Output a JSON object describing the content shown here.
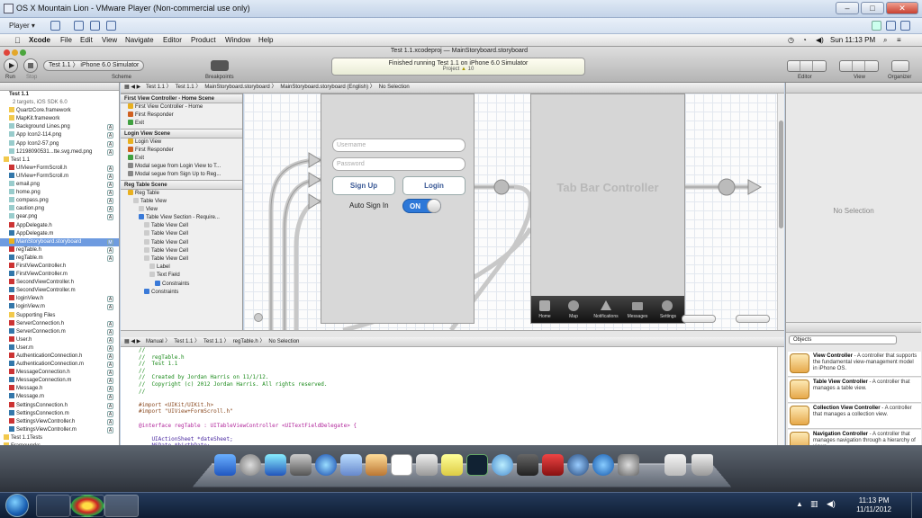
{
  "vmware": {
    "title": "OS X Mountain Lion - VMware Player (Non-commercial use only)",
    "player_menu": "Player"
  },
  "menubar": {
    "app": "Xcode",
    "items": [
      "File",
      "Edit",
      "View",
      "Navigate",
      "Editor",
      "Product",
      "Window",
      "Help"
    ],
    "clock": "Sun 11:13 PM"
  },
  "toolbar": {
    "run_label": "Run",
    "stop_label": "Stop",
    "scheme_label": "Scheme",
    "scheme_target": "Test 1.1",
    "scheme_dest": "iPhone 6.0 Simulator",
    "breakpoints_label": "Breakpoints",
    "window_title": "Test 1.1.xcodeproj — MainStoryboard.storyboard",
    "activity_text": "Finished running Test 1.1 on iPhone 6.0 Simulator",
    "activity_project": "Project",
    "activity_count": "10",
    "editor_label": "Editor",
    "view_label": "View",
    "organizer_label": "Organizer"
  },
  "jumpbar_top": {
    "items": [
      "Test 1.1",
      "Test 1.1",
      "MainStoryboard.storyboard",
      "MainStoryboard.storyboard (English)",
      "No Selection"
    ]
  },
  "navigator": {
    "project": "Test 1.1",
    "project_sub": "2 targets, iOS SDK 6.0",
    "files": [
      {
        "name": "QuartzCore.framework",
        "type": "folder",
        "indent": 1,
        "mark": ""
      },
      {
        "name": "MapKit.framework",
        "type": "folder",
        "indent": 1,
        "mark": ""
      },
      {
        "name": "Background Lines.png",
        "type": "img",
        "indent": 1,
        "mark": "A"
      },
      {
        "name": "App Icon2-114.png",
        "type": "img",
        "indent": 1,
        "mark": "A"
      },
      {
        "name": "App Icon2-57.png",
        "type": "img",
        "indent": 1,
        "mark": "A"
      },
      {
        "name": "12198090531...tte.svg.med.png",
        "type": "img",
        "indent": 1,
        "mark": "A"
      },
      {
        "name": "Test 1.1",
        "type": "folder",
        "indent": 0,
        "mark": ""
      },
      {
        "name": "UIView+FormScroll.h",
        "type": "h",
        "indent": 1,
        "mark": "A"
      },
      {
        "name": "UIView+FormScroll.m",
        "type": "m",
        "indent": 1,
        "mark": "A"
      },
      {
        "name": "email.png",
        "type": "img",
        "indent": 1,
        "mark": "A"
      },
      {
        "name": "home.png",
        "type": "img",
        "indent": 1,
        "mark": "A"
      },
      {
        "name": "compass.png",
        "type": "img",
        "indent": 1,
        "mark": "A"
      },
      {
        "name": "caution.png",
        "type": "img",
        "indent": 1,
        "mark": "A"
      },
      {
        "name": "gear.png",
        "type": "img",
        "indent": 1,
        "mark": "A"
      },
      {
        "name": "AppDelegate.h",
        "type": "h",
        "indent": 1,
        "mark": ""
      },
      {
        "name": "AppDelegate.m",
        "type": "m",
        "indent": 1,
        "mark": ""
      },
      {
        "name": "MainStoryboard.storyboard",
        "type": "sb",
        "indent": 1,
        "mark": "M",
        "selected": true
      },
      {
        "name": "regTable.h",
        "type": "h",
        "indent": 1,
        "mark": "A"
      },
      {
        "name": "regTable.m",
        "type": "m",
        "indent": 1,
        "mark": "A"
      },
      {
        "name": "FirstViewController.h",
        "type": "h",
        "indent": 1,
        "mark": ""
      },
      {
        "name": "FirstViewController.m",
        "type": "m",
        "indent": 1,
        "mark": ""
      },
      {
        "name": "SecondViewController.h",
        "type": "h",
        "indent": 1,
        "mark": ""
      },
      {
        "name": "SecondViewController.m",
        "type": "m",
        "indent": 1,
        "mark": ""
      },
      {
        "name": "loginView.h",
        "type": "h",
        "indent": 1,
        "mark": "A"
      },
      {
        "name": "loginView.m",
        "type": "m",
        "indent": 1,
        "mark": "A"
      },
      {
        "name": "Supporting Files",
        "type": "folder",
        "indent": 1,
        "mark": ""
      },
      {
        "name": "ServerConnection.h",
        "type": "h",
        "indent": 1,
        "mark": "A"
      },
      {
        "name": "ServerConnection.m",
        "type": "m",
        "indent": 1,
        "mark": "A"
      },
      {
        "name": "User.h",
        "type": "h",
        "indent": 1,
        "mark": "A"
      },
      {
        "name": "User.m",
        "type": "m",
        "indent": 1,
        "mark": "A"
      },
      {
        "name": "AuthenticationConnection.h",
        "type": "h",
        "indent": 1,
        "mark": "A"
      },
      {
        "name": "AuthenticationConnection.m",
        "type": "m",
        "indent": 1,
        "mark": "A"
      },
      {
        "name": "MessageConnection.h",
        "type": "h",
        "indent": 1,
        "mark": "A"
      },
      {
        "name": "MessageConnection.m",
        "type": "m",
        "indent": 1,
        "mark": "A"
      },
      {
        "name": "Message.h",
        "type": "h",
        "indent": 1,
        "mark": "A"
      },
      {
        "name": "Message.m",
        "type": "m",
        "indent": 1,
        "mark": "A"
      },
      {
        "name": "SettingsConnection.h",
        "type": "h",
        "indent": 1,
        "mark": "A"
      },
      {
        "name": "SettingsConnection.m",
        "type": "m",
        "indent": 1,
        "mark": "A"
      },
      {
        "name": "SettingsViewController.h",
        "type": "h",
        "indent": 1,
        "mark": "A"
      },
      {
        "name": "SettingsViewController.m",
        "type": "m",
        "indent": 1,
        "mark": "A"
      },
      {
        "name": "Test 1.1Tests",
        "type": "folder",
        "indent": 0,
        "mark": ""
      },
      {
        "name": "Frameworks",
        "type": "folder",
        "indent": 0,
        "mark": ""
      }
    ]
  },
  "outline": {
    "sections": [
      {
        "title": "First View Controller - Home Scene",
        "rows": [
          {
            "t": "First View Controller - Home",
            "c": "#e8b020",
            "i": 1
          },
          {
            "t": "First Responder",
            "c": "#d06020",
            "i": 1
          },
          {
            "t": "Exit",
            "c": "#40a040",
            "i": 1
          }
        ]
      },
      {
        "title": "Login View Scene",
        "rows": [
          {
            "t": "Login View",
            "c": "#e8b020",
            "i": 1
          },
          {
            "t": "First Responder",
            "c": "#d06020",
            "i": 1
          },
          {
            "t": "Exit",
            "c": "#40a040",
            "i": 1
          },
          {
            "t": "Modal segue from Login View to T...",
            "c": "#888888",
            "i": 1
          },
          {
            "t": "Modal segue from Sign Up to Reg...",
            "c": "#888888",
            "i": 1
          }
        ]
      },
      {
        "title": "Reg Table Scene",
        "rows": [
          {
            "t": "Reg Table",
            "c": "#e8b020",
            "i": 1
          },
          {
            "t": "Table View",
            "c": "#cccccc",
            "i": 2
          },
          {
            "t": "View",
            "c": "#cccccc",
            "i": 3
          },
          {
            "t": "Table View Section - Require...",
            "c": "#3a7ad8",
            "i": 3
          },
          {
            "t": "Table View Cell",
            "c": "#cccccc",
            "i": 4
          },
          {
            "t": "Table View Cell",
            "c": "#cccccc",
            "i": 4
          },
          {
            "t": "Table View Cell",
            "c": "#cccccc",
            "i": 4
          },
          {
            "t": "Table View Cell",
            "c": "#cccccc",
            "i": 4
          },
          {
            "t": "Table View Cell",
            "c": "#cccccc",
            "i": 4
          },
          {
            "t": "Label",
            "c": "#cccccc",
            "i": 5
          },
          {
            "t": "Text Field",
            "c": "#cccccc",
            "i": 5
          },
          {
            "t": "Constraints",
            "c": "#3a7ad8",
            "i": 6
          },
          {
            "t": "Constraints",
            "c": "#3a7ad8",
            "i": 4
          }
        ]
      }
    ]
  },
  "canvas": {
    "username_placeholder": "Username",
    "password_placeholder": "Password",
    "signup_label": "Sign Up",
    "login_label": "Login",
    "autosignin_label": "Auto Sign In",
    "toggle_label": "ON",
    "tabbar_title": "Tab Bar Controller",
    "tabs": [
      "Home",
      "Map",
      "Notifications",
      "Messages",
      "Settings"
    ]
  },
  "jumpbar_editor": {
    "items": [
      "Manual",
      "Test 1.1",
      "Test 1.1",
      "regTable.h",
      "No Selection"
    ]
  },
  "editor": {
    "lines": [
      {
        "cls": "cm",
        "text": "//"
      },
      {
        "cls": "cm",
        "text": "//  regTable.h"
      },
      {
        "cls": "cm",
        "text": "//  Test 1.1"
      },
      {
        "cls": "cm",
        "text": "//"
      },
      {
        "cls": "cm",
        "text": "//  Created by Jordan Harris on 11/1/12."
      },
      {
        "cls": "cm",
        "text": "//  Copyright (c) 2012 Jordan Harris. All rights reserved."
      },
      {
        "cls": "cm",
        "text": "//"
      },
      {
        "cls": "",
        "text": ""
      },
      {
        "cls": "pp",
        "text": "#import <UIKit/UIKit.h>"
      },
      {
        "cls": "pp",
        "text": "#import \"UIView+FormScroll.h\""
      },
      {
        "cls": "",
        "text": ""
      },
      {
        "cls": "kw",
        "text": "@interface regTable : UITableViewController <UITextFieldDelegate> {"
      },
      {
        "cls": "",
        "text": ""
      },
      {
        "cls": "ty",
        "text": "    UIActionSheet *dateSheet;"
      },
      {
        "cls": "ty",
        "text": "    NSDate *birthDate;"
      },
      {
        "cls": "",
        "text": ""
      },
      {
        "cls": "",
        "text": "}"
      }
    ]
  },
  "utilities": {
    "selection": "No Selection",
    "library_filter": "Objects",
    "items": [
      {
        "title": "View Controller",
        "desc": " - A controller that supports the fundamental view-management model in iPhone OS."
      },
      {
        "title": "Table View Controller",
        "desc": " - A controller that manages a table view."
      },
      {
        "title": "Collection View Controller",
        "desc": " - A controller that manages a collection view."
      },
      {
        "title": "Navigation Controller",
        "desc": " - A controller that manages navigation through a hierarchy of views."
      }
    ]
  },
  "taskbar": {
    "time": "11:13 PM",
    "date": "11/11/2012"
  }
}
